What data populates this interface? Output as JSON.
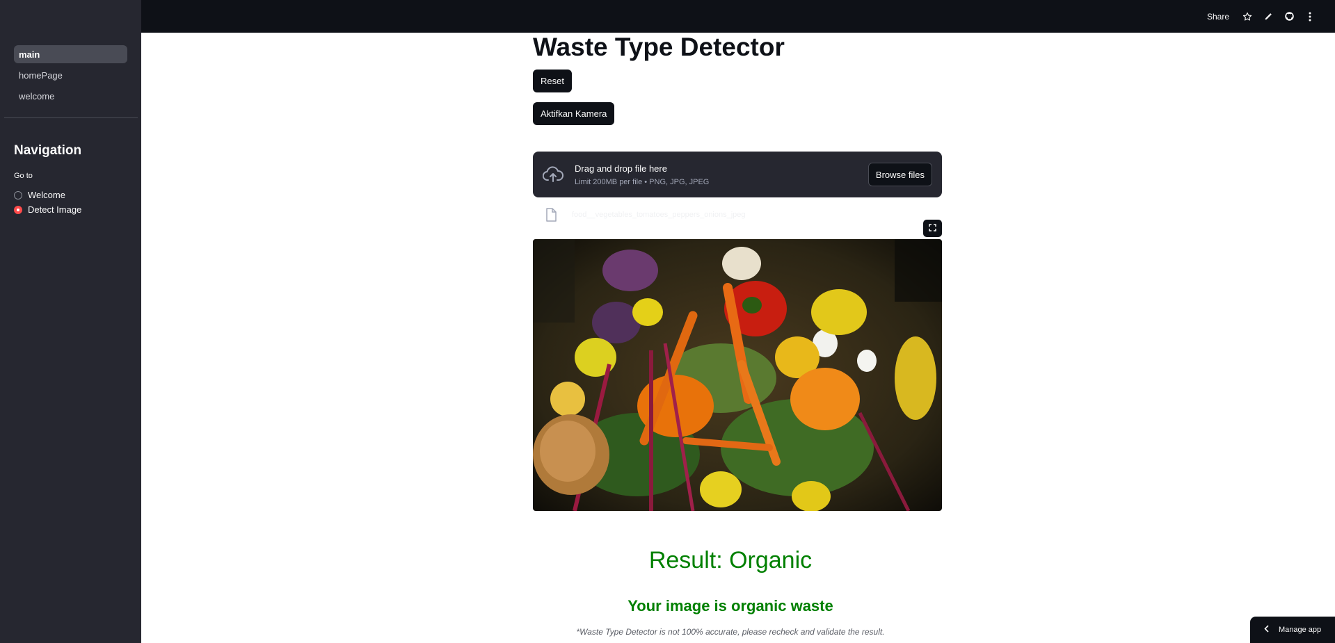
{
  "sidebar": {
    "pages": [
      {
        "label": "main",
        "active": true
      },
      {
        "label": "homePage",
        "active": false
      },
      {
        "label": "welcome",
        "active": false
      }
    ],
    "nav_heading": "Navigation",
    "goto_label": "Go to",
    "radio_options": [
      {
        "label": "Welcome",
        "selected": false
      },
      {
        "label": "Detect Image",
        "selected": true
      }
    ]
  },
  "header": {
    "share_label": "Share",
    "icons": [
      "star-icon",
      "edit-icon",
      "github-icon",
      "more-menu-icon"
    ]
  },
  "main": {
    "title": "Waste Type Detector",
    "reset_label": "Reset",
    "camera_label": "Aktifkan Kamera",
    "uploader": {
      "main_text": "Drag and drop file here",
      "sub_text": "Limit 200MB per file • PNG, JPG, JPEG",
      "browse_label": "Browse files"
    },
    "uploaded_file": {
      "name": "food__vegetables_tomatoes_peppers_onions_jpeg"
    },
    "image": {
      "alt": "Food waste: vegetables, peppers, carrots, beets, onion and egg shells"
    },
    "result_title": "Result: Organic",
    "result_subtitle": "Your image is organic waste",
    "disclaimer": "*Waste Type Detector is not 100% accurate, please recheck and validate the result."
  },
  "footer": {
    "manage_app_label": "Manage app"
  },
  "colors": {
    "sidebar_bg": "#262730",
    "header_bg": "#0e1117",
    "accent": "#ff4b4b",
    "result_green": "#008000"
  }
}
